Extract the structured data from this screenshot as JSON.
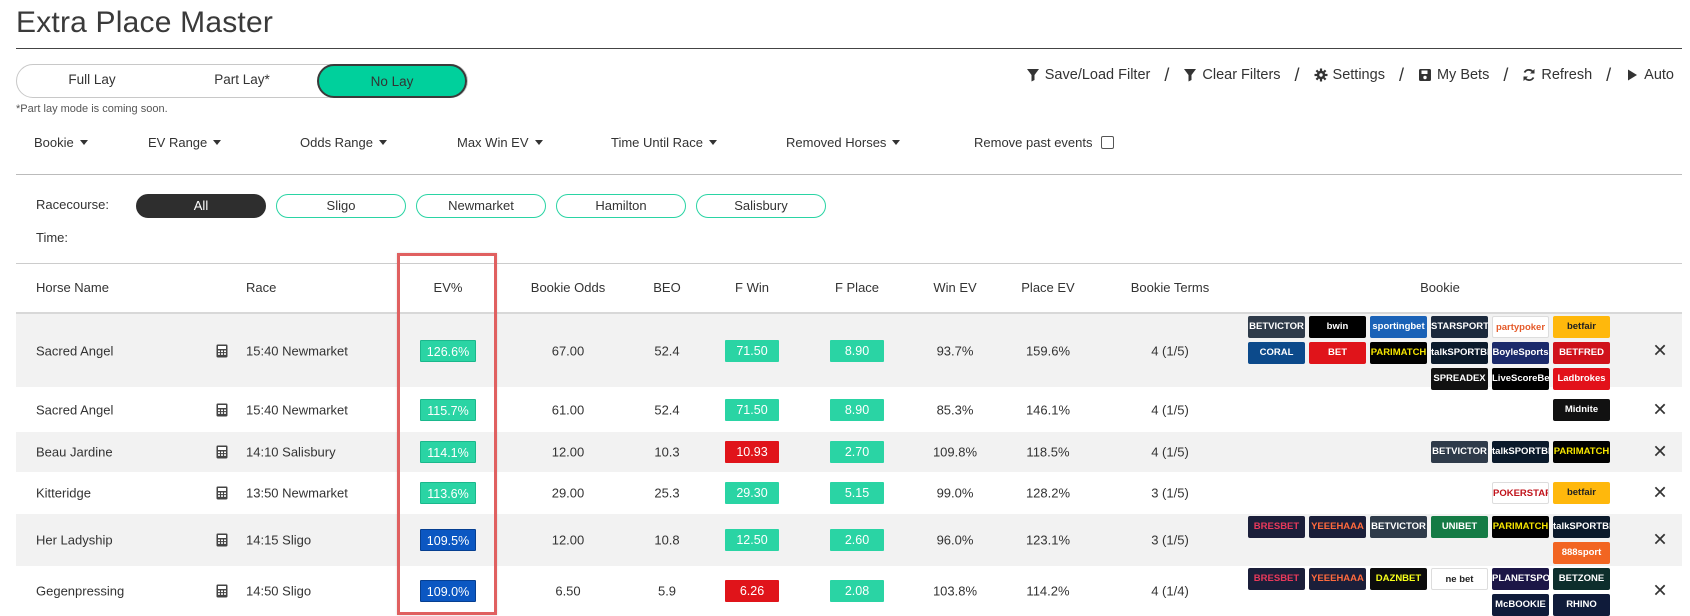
{
  "page_title": "Extra Place Master",
  "modes": [
    {
      "label": "Full Lay",
      "active": false
    },
    {
      "label": "Part Lay*",
      "active": false
    },
    {
      "label": "No Lay",
      "active": true
    }
  ],
  "mode_note": "*Part lay mode is coming soon.",
  "toolbar": [
    {
      "label": "Save/Load Filter",
      "icon": "filter-icon"
    },
    {
      "label": "Clear Filters",
      "icon": "filter-icon"
    },
    {
      "label": "Settings",
      "icon": "gear-icon"
    },
    {
      "label": "My Bets",
      "icon": "save-icon"
    },
    {
      "label": "Refresh",
      "icon": "refresh-icon"
    },
    {
      "label": "Auto",
      "icon": "play-icon"
    }
  ],
  "filters": {
    "bookie": "Bookie",
    "ev_range": "EV Range",
    "odds_range": "Odds Range",
    "max_win_ev": "Max Win EV",
    "time_until_race": "Time Until Race",
    "removed_horses": "Removed Horses",
    "remove_past_events": "Remove past events"
  },
  "racecourse_label": "Racecourse:",
  "time_label": "Time:",
  "racecourses": [
    "All",
    "Sligo",
    "Newmarket",
    "Hamilton",
    "Salisbury"
  ],
  "columns": {
    "horse": "Horse Name",
    "race": "Race",
    "ev": "EV%",
    "bookie_odds": "Bookie Odds",
    "beo": "BEO",
    "f_win": "F Win",
    "f_place": "F Place",
    "win_ev": "Win EV",
    "place_ev": "Place EV",
    "terms": "Bookie Terms",
    "bookie": "Bookie"
  },
  "rows": [
    {
      "horse": "Sacred Angel",
      "race": "15:40 Newmarket",
      "ev": "126.6%",
      "ev_color": "green",
      "bookie_odds": "67.00",
      "beo": "52.4",
      "f_win": "71.50",
      "f_win_color": "green",
      "f_place": "8.90",
      "win_ev": "93.7%",
      "place_ev": "159.6%",
      "terms": "4 (1/5)",
      "bookies": [
        [
          "BETVICTOR",
          "bwin",
          "sportingbet",
          "STARSPORTS",
          "partypoker",
          "betfair"
        ],
        [
          "CORAL",
          "BET",
          "PARIMATCH",
          "talkSPORTBET",
          "BoyleSports",
          "BETFRED"
        ],
        [
          "SPREADEX",
          "LiveScoreBet",
          "Ladbrokes"
        ]
      ]
    },
    {
      "horse": "Sacred Angel",
      "race": "15:40 Newmarket",
      "ev": "115.7%",
      "ev_color": "green",
      "bookie_odds": "61.00",
      "beo": "52.4",
      "f_win": "71.50",
      "f_win_color": "green",
      "f_place": "8.90",
      "win_ev": "85.3%",
      "place_ev": "146.1%",
      "terms": "4 (1/5)",
      "bookies": [
        [
          "Midnite"
        ]
      ]
    },
    {
      "horse": "Beau Jardine",
      "race": "14:10 Salisbury",
      "ev": "114.1%",
      "ev_color": "green",
      "bookie_odds": "12.00",
      "beo": "10.3",
      "f_win": "10.93",
      "f_win_color": "red",
      "f_place": "2.70",
      "win_ev": "109.8%",
      "place_ev": "118.5%",
      "terms": "4 (1/5)",
      "bookies": [
        [
          "BETVICTOR",
          "talkSPORTBET",
          "PARIMATCH"
        ]
      ]
    },
    {
      "horse": "Kitteridge",
      "race": "13:50 Newmarket",
      "ev": "113.6%",
      "ev_color": "green",
      "bookie_odds": "29.00",
      "beo": "25.3",
      "f_win": "29.30",
      "f_win_color": "green",
      "f_place": "5.15",
      "win_ev": "99.0%",
      "place_ev": "128.2%",
      "terms": "3 (1/5)",
      "bookies": [
        [
          "POKERSTARS",
          "betfair"
        ]
      ]
    },
    {
      "horse": "Her Ladyship",
      "race": "14:15 Sligo",
      "ev": "109.5%",
      "ev_color": "blue",
      "bookie_odds": "12.00",
      "beo": "10.8",
      "f_win": "12.50",
      "f_win_color": "green",
      "f_place": "2.60",
      "win_ev": "96.0%",
      "place_ev": "123.1%",
      "terms": "3 (1/5)",
      "bookies": [
        [
          "BRESBET",
          "YEEEHAAA",
          "BETVICTOR",
          "UNIBET",
          "PARIMATCH",
          "talkSPORTBET"
        ],
        [
          "888sport"
        ]
      ]
    },
    {
      "horse": "Gegenpressing",
      "race": "14:50 Sligo",
      "ev": "109.0%",
      "ev_color": "blue",
      "bookie_odds": "6.50",
      "beo": "5.9",
      "f_win": "6.26",
      "f_win_color": "red",
      "f_place": "2.08",
      "win_ev": "103.8%",
      "place_ev": "114.2%",
      "terms": "4 (1/4)",
      "bookies": [
        [
          "BRESBET",
          "YEEEHAAA",
          "DAZNBET",
          "ne bet",
          "PLANETSPORTBET",
          "BETZONE"
        ],
        [
          "McBOOKIE",
          "RHINO"
        ]
      ]
    }
  ],
  "colors": {
    "accent": "#00d09c",
    "ev_green": "#2ad4a4",
    "ev_blue": "#0b57c2",
    "red": "#e0141a",
    "highlight": "#e06060"
  }
}
